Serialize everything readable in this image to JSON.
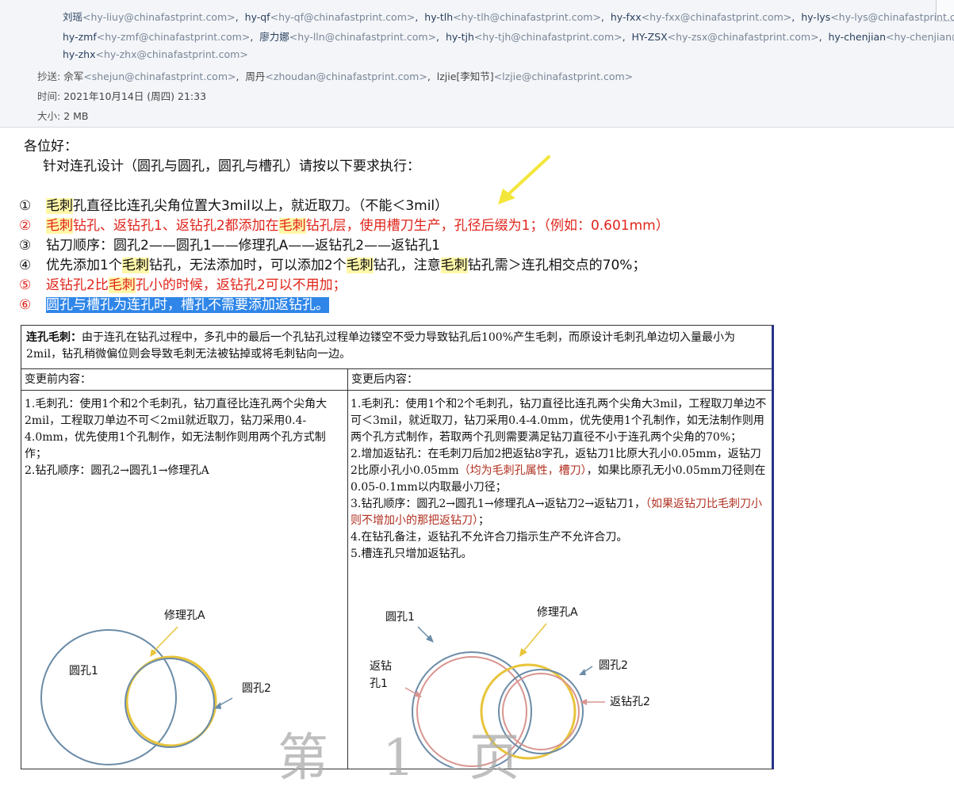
{
  "header": {
    "to_line1": [
      {
        "name": "刘瑶",
        "email": "<hy-liuy@chinafastprint.com>"
      },
      {
        "name": "hy-qf",
        "email": "<hy-qf@chinafastprint.com>"
      },
      {
        "name": "hy-tlh",
        "email": "<hy-tlh@chinafastprint.com>"
      },
      {
        "name": "hy-fxx",
        "email": "<hy-fxx@chinafastprint.com>"
      },
      {
        "name": "hy-lys",
        "email": "<hy-lys@chinafastprint.com>"
      }
    ],
    "to_line2": [
      {
        "name": "hy-zmf",
        "email": "<hy-zmf@chinafastprint.com>"
      },
      {
        "name": "廖力娜",
        "email": "<hy-lln@chinafastprint.com>"
      },
      {
        "name": "hy-tjh",
        "email": "<hy-tjh@chinafastprint.com>"
      },
      {
        "name": "HY-ZSX",
        "email": "<hy-zsx@chinafastprint.com>"
      },
      {
        "name": "hy-chenjian",
        "email": "<hy-chenjian@"
      }
    ],
    "to_line3": [
      {
        "name": "hy-zhx",
        "email": "<hy-zhx@chinafastprint.com>"
      }
    ],
    "cc_label": "抄送:",
    "cc": [
      {
        "name": "佘军",
        "email": "<shejun@chinafastprint.com>"
      },
      {
        "name": "周丹",
        "email": "<zhoudan@chinafastprint.com>"
      },
      {
        "name": "lzjie[李知节]",
        "email": "<lzjie@chinafastprint.com>"
      }
    ],
    "time_label": "时间:",
    "time_value": "2021年10月14日 (周四) 21:33",
    "size_label": "大小:",
    "size_value": "2 MB"
  },
  "body": {
    "greeting": "各位好：",
    "intro": "针对连孔设计（圆孔与圆孔，圆孔与槽孔）请按以下要求执行：",
    "rules": {
      "r1": {
        "num": "①",
        "a": "毛刺",
        "b": "孔直径比连孔尖角位置大3mil以上，就近取刀。（不能＜3mil）"
      },
      "r2": {
        "num": "②",
        "a": "毛刺",
        "b": "钻孔、返钻孔1、返钻孔2都添加在",
        "c": "毛刺",
        "d": "钻孔层，使用槽刀生产，孔径后缀为1；（例如：0.601mm）"
      },
      "r3": {
        "num": "③",
        "a": "钻刀顺序：圆孔2——圆孔1——修理孔A——返钻孔2——返钻孔1"
      },
      "r4": {
        "num": "④",
        "a": "优先添加1个",
        "b": "毛刺",
        "c": "钻孔，无法添加时，可以添加2个",
        "d": "毛刺",
        "e": "钻孔，注意",
        "f": "毛刺",
        "g": "钻孔需＞连孔相交点的70%；"
      },
      "r5": {
        "num": "⑤",
        "a": "返钻孔2比",
        "b": "毛刺",
        "c": "孔小的时候，返钻孔2可以不用加；"
      },
      "r6": {
        "num": "⑥",
        "a": "圆孔与槽孔为连孔时，槽孔不需要添加返钻孔。"
      }
    },
    "table": {
      "title_bold": "连孔毛刺：",
      "title_text": "由于连孔在钻孔过程中，多孔中的最后一个孔钻孔过程单边镂空不受力导致钻孔后100%产生毛刺，而原设计毛刺孔单边切入量最小为2mil，钻孔稍微偏位则会导致毛刺无法被钻掉或将毛刺钻向一边。",
      "before_header": "变更前内容：",
      "after_header": "变更后内容：",
      "before": {
        "p1": "1.毛刺孔：使用1个和2个毛刺孔，钻刀直径比连孔两个尖角大2mil，工程取刀单边不可＜2mil就近取刀，钻刀采用0.4-4.0mm，优先使用1个孔制作，如无法制作则用两个孔方式制作；",
        "p2": "2.钻孔顺序：圆孔2→圆孔1→修理孔A"
      },
      "after": {
        "p1": "1.毛刺孔：使用1个和2个毛刺孔，钻刀直径比连孔两个尖角大3mil，工程取刀单边不可＜3mil，就近取刀，钻刀采用0.4-4.0mm，优先使用1个孔制作，如无法制作则用两个孔方式制作，若取两个孔则需要满足钻刀直径不小于连孔两个尖角的70%；",
        "p2a": "2.增加返钻孔：在毛刺刀后加2把返钻8字孔，返钻刀1比原大孔小0.05mm，返钻刀2比原小孔小0.05mm",
        "p2b": "（均为毛刺孔属性，槽刀）",
        "p2c": "，如果比原孔无小0.05mm刀径则在0.05-0.1mm以内取最小刀径；",
        "p3a": "3.钻孔顺序：圆孔2→圆孔1→修理孔A→返钻刀2→返钻刀1，",
        "p3b": "（如果返钻刀比毛刺刀小则不增加小的那把返钻刀）",
        "p3c": "；",
        "p4": "4.在钻孔备注，返钻孔不允许合刀指示生产不允许合刀。",
        "p5": "5.槽连孔只增加返钻孔。"
      },
      "diagram_left": {
        "a": "修理孔A",
        "b": "圆孔1",
        "c": "圆孔2"
      },
      "diagram_right": {
        "a": "圆孔1",
        "b": "修理孔A",
        "c": "圆孔2",
        "d1": "返钻",
        "d2": "孔1",
        "e": "返钻孔2"
      }
    },
    "watermark": "第 1 页"
  },
  "colors": {
    "blue_circle": "#6b8ca8",
    "yellow_circle": "#e8c43a",
    "pink_circle": "#d89590",
    "arrow_yellow": "#f3e63a"
  }
}
